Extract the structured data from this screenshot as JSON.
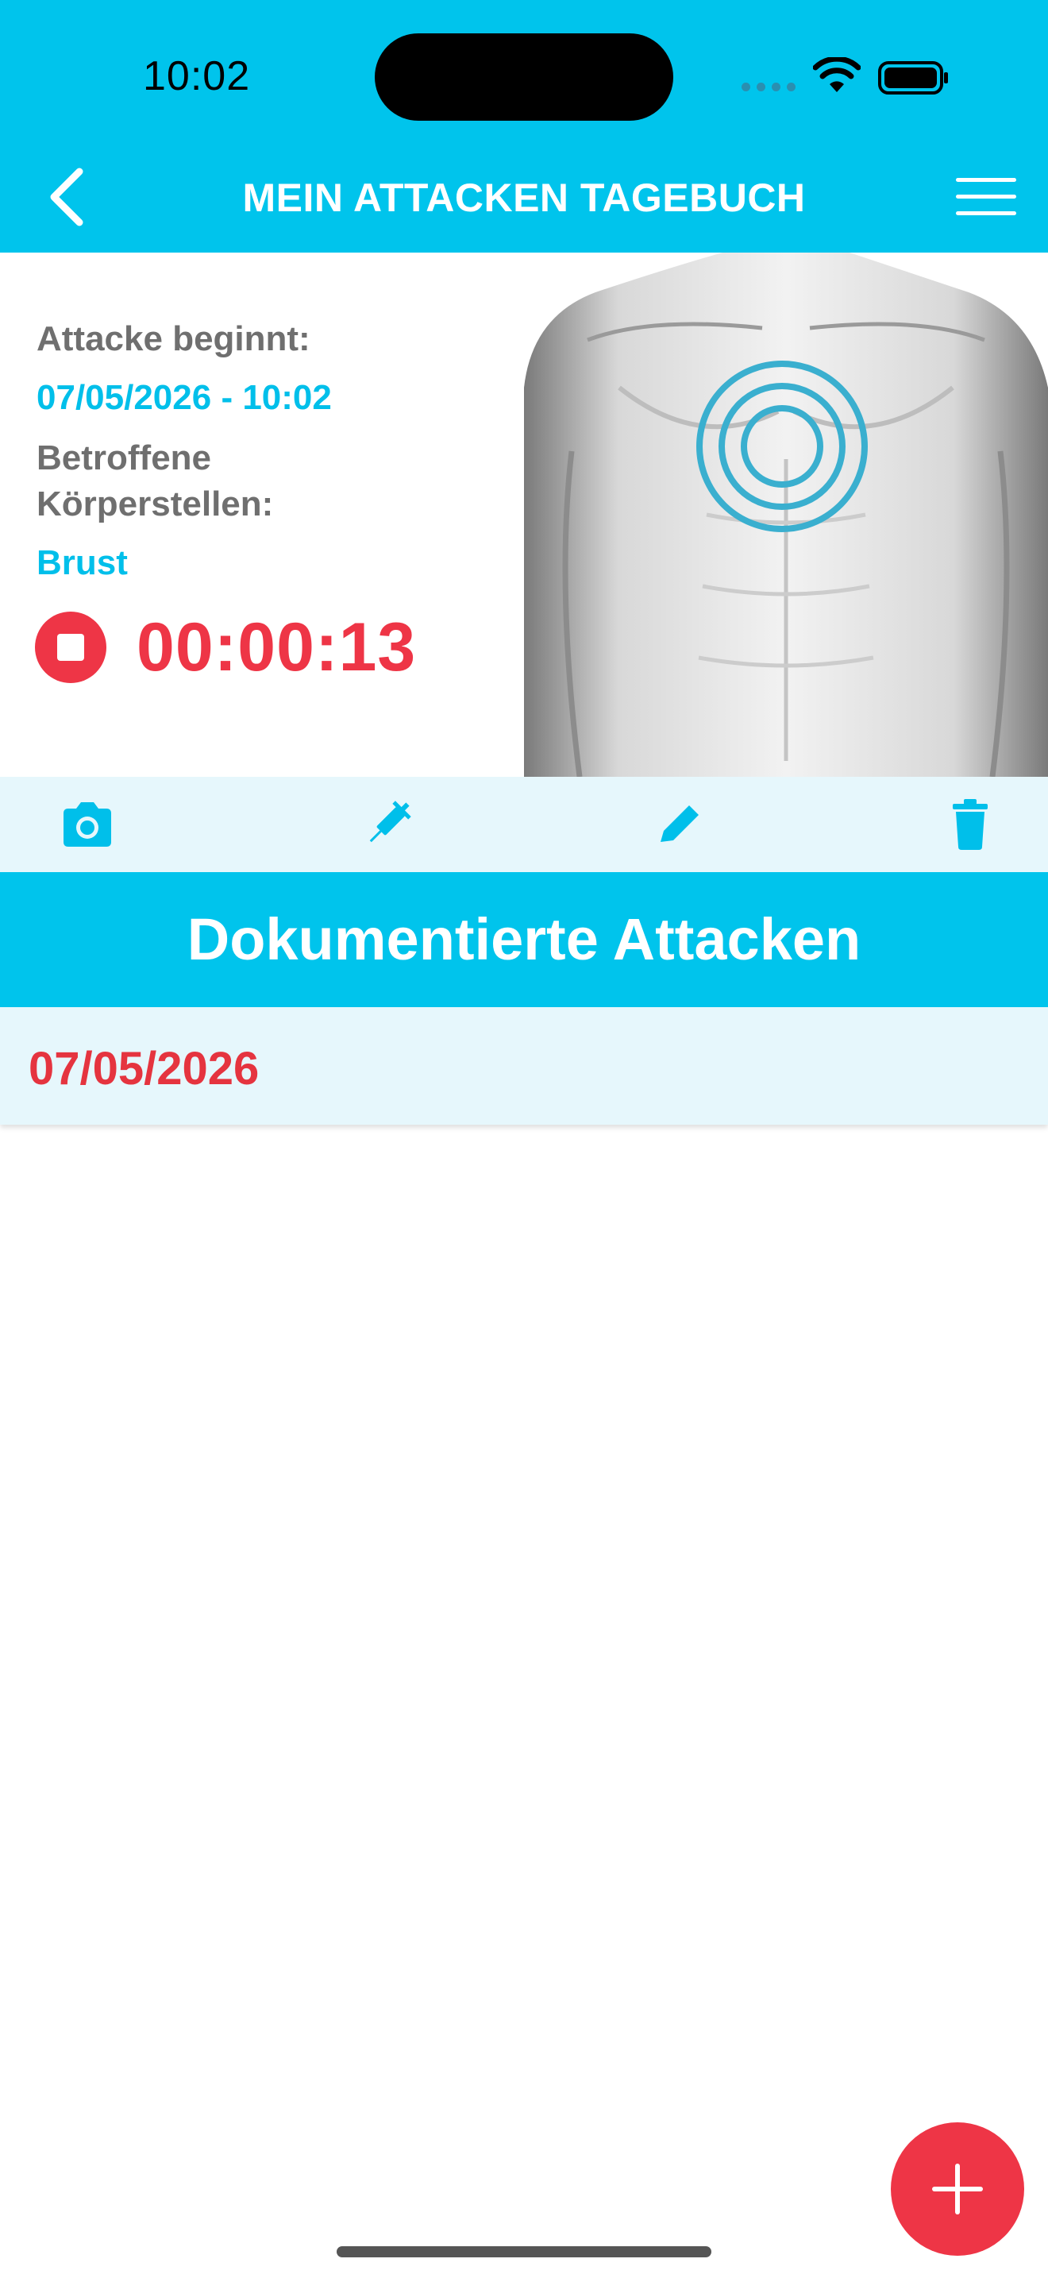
{
  "status_bar": {
    "time": "10:02"
  },
  "header": {
    "title": "MEIN ATTACKEN TAGEBUCH"
  },
  "attack": {
    "start_label": "Attacke beginnt:",
    "start_value": "07/05/2026 - 10:02",
    "body_parts_label_line1": "Betroffene",
    "body_parts_label_line2": "Körperstellen:",
    "body_parts_value": "Brust",
    "timer": "00:00:13"
  },
  "toolbar": {
    "icons": [
      "camera-icon",
      "syringe-icon",
      "pencil-icon",
      "trash-icon"
    ]
  },
  "section": {
    "title": "Dokumentierte Attacken"
  },
  "entries": [
    {
      "date": "07/05/2026"
    }
  ],
  "colors": {
    "accent": "#00C4EC",
    "danger": "#EE3546",
    "light": "#E6F7FC"
  }
}
